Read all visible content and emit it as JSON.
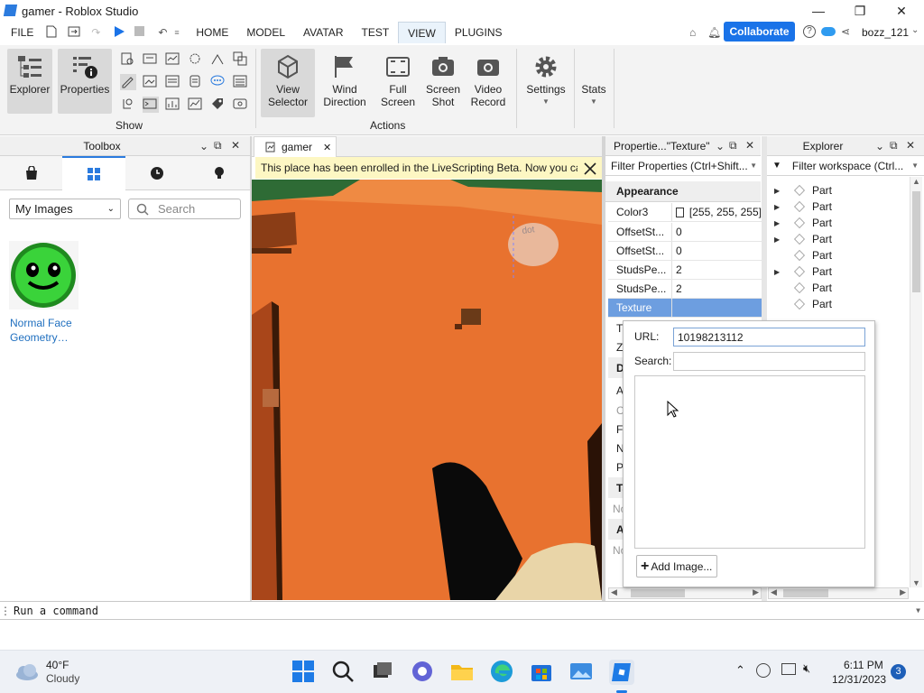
{
  "window": {
    "title": "gamer - Roblox Studio",
    "minimize": "—",
    "maximize": "❐",
    "close": "✕"
  },
  "menu": {
    "items": [
      "FILE",
      "HOME",
      "MODEL",
      "AVATAR",
      "TEST",
      "VIEW",
      "PLUGINS"
    ],
    "active": "VIEW",
    "collaborate": "Collaborate",
    "user": "bozz_121"
  },
  "ribbon": {
    "explorer": "Explorer",
    "properties": "Properties",
    "show_group": "Show",
    "view_selector": [
      "View",
      "Selector"
    ],
    "wind_direction": [
      "Wind",
      "Direction"
    ],
    "full_screen": [
      "Full",
      "Screen"
    ],
    "screen_shot": [
      "Screen",
      "Shot"
    ],
    "video_record": [
      "Video",
      "Record"
    ],
    "actions_group": "Actions",
    "settings": "Settings",
    "stats": "Stats"
  },
  "toolbox": {
    "title": "Toolbox",
    "dropdown_value": "My Images",
    "search_placeholder": "Search",
    "item": {
      "name": "Normal Face Geometry…",
      "line1": "Normal Face",
      "line2": "Geometry…"
    }
  },
  "tab": {
    "label": "gamer"
  },
  "banner": {
    "text": "This place has been enrolled in the LiveScripting Beta. Now you can co"
  },
  "properties": {
    "title": "Propertie...\"Texture\"",
    "filter_placeholder": "Filter Properties (Ctrl+Shift...",
    "section": "Appearance",
    "rows": [
      {
        "key": "Color3",
        "value": "[255, 255, 255]"
      },
      {
        "key": "OffsetSt...",
        "value": "0"
      },
      {
        "key": "OffsetSt...",
        "value": "0"
      },
      {
        "key": "StudsPe...",
        "value": "2"
      },
      {
        "key": "StudsPe...",
        "value": "2"
      },
      {
        "key": "Texture",
        "value": ""
      }
    ],
    "hidden_rows": [
      "Tr",
      "ZI",
      "D",
      "Ar",
      "Cl",
      "Fa",
      "N",
      "Pa",
      "Ta",
      "No",
      "At",
      "No"
    ]
  },
  "explorer": {
    "title": "Explorer",
    "filter_placeholder": "Filter workspace (Ctrl...",
    "items": [
      "Part",
      "Part",
      "Part",
      "Part",
      "Part",
      "Part",
      "Part",
      "Part"
    ]
  },
  "texture_popup": {
    "url_label": "URL:",
    "url_value": "10198213112",
    "search_label": "Search:",
    "search_value": "",
    "add_image": "Add Image..."
  },
  "command_bar": {
    "placeholder": "Run a command"
  },
  "taskbar": {
    "weather_temp": "40°F",
    "weather_desc": "Cloudy",
    "time": "6:11 PM",
    "date": "12/31/2023",
    "notifications": "3"
  },
  "viewport": {
    "top_label": "dot"
  },
  "colors": {
    "accent": "#1a73e8",
    "viewport_floor": "#e8722f",
    "selection": "#6d9ee0",
    "banner": "#fdf7c3"
  }
}
